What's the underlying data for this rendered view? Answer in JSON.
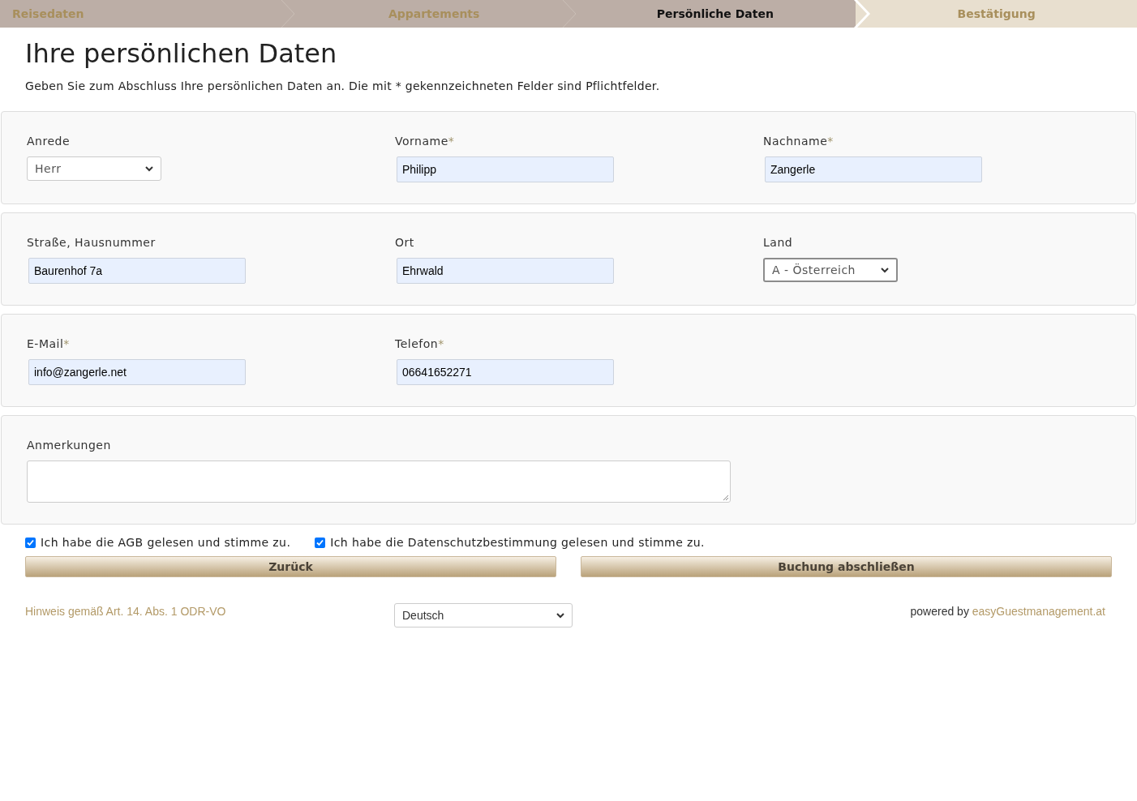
{
  "steps": [
    {
      "label": "Reisedaten",
      "completed": true,
      "selected": false
    },
    {
      "label": "Appartements",
      "completed": true,
      "selected": false
    },
    {
      "label": "Persönliche Daten",
      "completed": true,
      "selected": true
    },
    {
      "label": "Bestätigung",
      "completed": false,
      "selected": false
    }
  ],
  "title": "Ihre persönlichen Daten",
  "intro": "Geben Sie zum Abschluss Ihre persönlichen Daten an. Die mit * gekennzeichneten Felder sind Pflichtfelder.",
  "sections": [
    {
      "fields": [
        {
          "kind": "select",
          "label": "Anrede",
          "value": "Herr",
          "focused": false
        },
        {
          "kind": "input",
          "label": "Vorname",
          "required_mark": "*",
          "value": "Philipp"
        },
        {
          "kind": "input",
          "label": "Nachname",
          "required_mark": "*",
          "value": "Zangerle"
        }
      ]
    },
    {
      "fields": [
        {
          "kind": "input",
          "label": "Straße, Hausnummer",
          "value": "Baurenhof 7a"
        },
        {
          "kind": "input",
          "label": "Ort",
          "value": "Ehrwald"
        },
        {
          "kind": "select",
          "label": "Land",
          "value": "A - Österreich",
          "focused": true
        }
      ]
    },
    {
      "fields": [
        {
          "kind": "input",
          "label": "E-Mail",
          "required_mark": "*",
          "value": "info@zangerle.net"
        },
        {
          "kind": "input",
          "label": "Telefon",
          "required_mark": "*",
          "value": "06641652271"
        }
      ]
    },
    {
      "fields": [
        {
          "kind": "textarea",
          "label": "Anmerkungen"
        }
      ]
    }
  ],
  "consents": [
    {
      "label": "Ich habe die AGB gelesen und stimme zu.",
      "checked": true
    },
    {
      "label": "Ich habe die Datenschutzbestimmung gelesen und stimme zu.",
      "checked": true
    }
  ],
  "buttons": [
    "Zurück",
    "Buchung abschließen"
  ],
  "footer": {
    "notice_link": "Hinweis gemäß Art. 14. Abs. 1 ODR-VO",
    "language": "Deutsch",
    "powered_by": "powered by",
    "powered_link": "easyGuestmanagement.at"
  }
}
